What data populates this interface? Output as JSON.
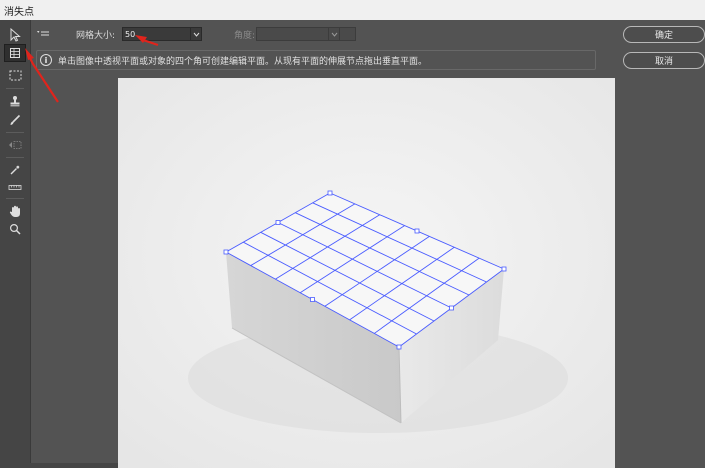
{
  "window": {
    "title": "消失点"
  },
  "tools": [
    {
      "name": "edit-plane-tool",
      "icon": "arrow-cursor-icon"
    },
    {
      "name": "create-plane-tool",
      "icon": "grid-plane-icon"
    },
    {
      "name": "marquee-tool",
      "icon": "dashed-rect-icon"
    },
    {
      "name": "stamp-tool",
      "icon": "stamp-icon"
    },
    {
      "name": "brush-tool",
      "icon": "brush-icon"
    },
    {
      "name": "transform-tool",
      "icon": "transform-icon"
    },
    {
      "name": "eyedropper-tool",
      "icon": "eyedropper-icon"
    },
    {
      "name": "measure-tool",
      "icon": "ruler-icon"
    },
    {
      "name": "hand-tool",
      "icon": "hand-icon"
    },
    {
      "name": "zoom-tool",
      "icon": "magnifier-icon"
    }
  ],
  "options": {
    "menu_icon": "panel-menu-icon",
    "grid_size_label": "网格大小:",
    "grid_size_value": "50",
    "angle_label": "角度:",
    "angle_value": ""
  },
  "info": {
    "icon": "info-icon",
    "icon_glyph": "i",
    "text": "单击图像中透视平面或对象的四个角可创建编辑平面。从现有平面的伸展节点拖出垂直平面。"
  },
  "buttons": {
    "ok": "确定",
    "cancel": "取消"
  },
  "colors": {
    "grid_line": "#4a5cff",
    "annotation_arrow": "#e0241c",
    "active_tool_bg": "#2f2f2f"
  }
}
